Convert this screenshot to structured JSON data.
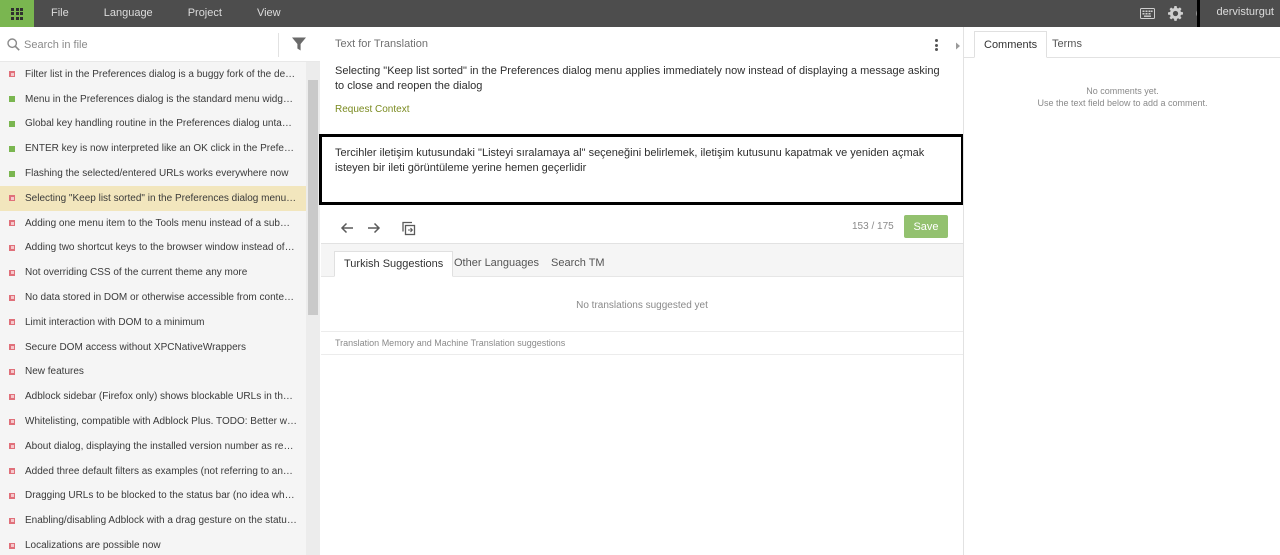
{
  "menu": [
    "File",
    "Language",
    "Project",
    "View"
  ],
  "user": {
    "name": "dervisturgut"
  },
  "icons": {
    "keyboard": "keyboard-icon",
    "settings": "gear-icon",
    "help": "help-icon"
  },
  "left": {
    "search_placeholder": "Search in file",
    "items": [
      {
        "text": "Filter list in the Preferences dialog is a buggy fork of the defa...",
        "status": "red"
      },
      {
        "text": "Menu in the Preferences dialog is the standard menu widget ...",
        "status": "green"
      },
      {
        "text": "Global key handling routine in the Preferences dialog untangl...",
        "status": "green"
      },
      {
        "text": "ENTER key is now interpreted like an OK click in the Preferenc...",
        "status": "green"
      },
      {
        "text": "Flashing the selected/entered URLs works everywhere now",
        "status": "green"
      },
      {
        "text": "Selecting \"Keep list sorted\" in the Preferences dialog menu a...",
        "status": "red",
        "selected": true
      },
      {
        "text": "Adding one menu item to the Tools menu instead of a subme...",
        "status": "red"
      },
      {
        "text": "Adding two shortcut keys to the browser window instead of fi...",
        "status": "red"
      },
      {
        "text": "Not overriding CSS of the current theme any more",
        "status": "red"
      },
      {
        "text": "No data stored in DOM or otherwise accessible from content ...",
        "status": "red"
      },
      {
        "text": "Limit interaction with DOM to a minimum",
        "status": "red"
      },
      {
        "text": "Secure DOM access without XPCNativeWrappers",
        "status": "red"
      },
      {
        "text": "New features",
        "status": "red"
      },
      {
        "text": "Adblock sidebar (Firefox only) shows blockable URLs in the cu...",
        "status": "red"
      },
      {
        "text": "Whitelisting, compatible with Adblock Plus. TODO: Better whit...",
        "status": "red"
      },
      {
        "text": "About dialog, displaying the installed version number as repo...",
        "status": "red"
      },
      {
        "text": "Added three default filters as examples (not referring to any s...",
        "status": "red"
      },
      {
        "text": "Dragging URLs to be blocked to the status bar (no idea what t...",
        "status": "red"
      },
      {
        "text": "Enabling/disabling Adblock with a drag gesture on the status ...",
        "status": "red"
      },
      {
        "text": "Localizations are possible now",
        "status": "red"
      }
    ]
  },
  "editor": {
    "title": "Text for Translation",
    "source": "Selecting \"Keep list sorted\" in the Preferences dialog menu applies immediately now instead of displaying a message asking to close and reopen the dialog",
    "request_context": "Request Context",
    "target": "Tercihler iletişim kutusundaki \"Listeyi sıralamaya al\" seçeneğini belirlemek, iletişim kutusunu kapatmak ve yeniden açmak isteyen bir ileti görüntüleme yerine hemen geçerlidir",
    "counter": "153 / 175",
    "save": "Save"
  },
  "suggestions": {
    "tabs": [
      "Turkish Suggestions",
      "Other Languages",
      "Search TM"
    ],
    "empty": "No translations suggested yet",
    "tm_label": "Translation Memory and Machine Translation suggestions"
  },
  "comments": {
    "tabs": [
      "Comments",
      "Terms"
    ],
    "empty_line1": "No comments yet.",
    "empty_line2": "Use the text field below to add a comment."
  },
  "colors": {
    "accent": "#7ab650",
    "topbar": "#4d4d4d",
    "selected_row": "#f2e6bd",
    "save": "#93c16f",
    "error": "#e0707a"
  }
}
